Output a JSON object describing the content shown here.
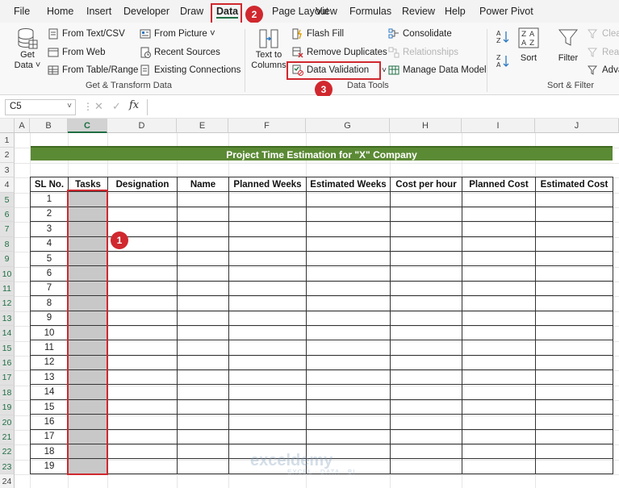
{
  "menu": [
    "File",
    "Home",
    "Insert",
    "Developer",
    "Draw",
    "Data",
    "Page Layout",
    "View",
    "Formulas",
    "Review",
    "Help",
    "Power Pivot"
  ],
  "ribbon": {
    "get_data": {
      "line1": "Get",
      "line2": "Data ˅"
    },
    "from_text_csv": "From Text/CSV",
    "from_web": "From Web",
    "from_table_range": "From Table/Range",
    "from_picture": "From Picture ˅",
    "recent_sources": "Recent Sources",
    "existing_connections": "Existing Connections",
    "group_get_transform": "Get & Transform Data",
    "text_to_columns": {
      "line1": "Text to",
      "line2": "Columns"
    },
    "flash_fill": "Flash Fill",
    "remove_duplicates": "Remove Duplicates",
    "data_validation": "Data Validation",
    "data_validation_arrow": "˅",
    "consolidate": "Consolidate",
    "relationships": "Relationships",
    "manage_data_model": "Manage Data Model",
    "group_data_tools": "Data Tools",
    "sort": "Sort",
    "filter": "Filter",
    "clear": "Clear",
    "reapply": "Reap",
    "advanced": "Adva",
    "group_sort_filter": "Sort & Filter"
  },
  "formula_bar": {
    "name_box": "C5",
    "fx": "fx",
    "value": ""
  },
  "columns": [
    "A",
    "B",
    "C",
    "D",
    "E",
    "F",
    "G",
    "H",
    "I",
    "J"
  ],
  "rows": [
    "1",
    "2",
    "3",
    "4",
    "5",
    "6",
    "7",
    "8",
    "9",
    "10",
    "11",
    "12",
    "13",
    "14",
    "15",
    "16",
    "17",
    "18",
    "19",
    "20",
    "21",
    "22",
    "23",
    "24"
  ],
  "sheet": {
    "title": "Project Time Estimation for \"X\" Company",
    "headers": [
      "SL No.",
      "Tasks",
      "Designation",
      "Name",
      "Planned Weeks",
      "Estimated Weeks",
      "Cost per hour",
      "Planned Cost",
      "Estimated Cost"
    ],
    "sl_numbers": [
      "1",
      "2",
      "3",
      "4",
      "5",
      "6",
      "7",
      "8",
      "9",
      "10",
      "11",
      "12",
      "13",
      "14",
      "15",
      "16",
      "17",
      "18",
      "19"
    ]
  },
  "callouts": [
    "1",
    "2",
    "3"
  ],
  "watermark": {
    "brand": "exceldemy",
    "tagline": "EXCEL · DATA · BI"
  },
  "colors": {
    "excel_green": "#1f6e43",
    "title_green": "#5b8a35",
    "callout_red": "#d0282e",
    "task_gray": "#c8c8c8"
  }
}
